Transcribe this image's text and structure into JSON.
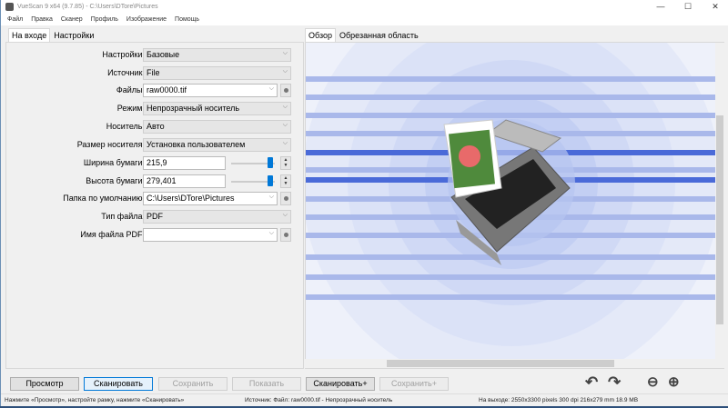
{
  "window": {
    "title": "VueScan 9 x64 (9.7.85) - C:\\Users\\DTore\\Pictures",
    "minimize": "—",
    "maximize": "☐",
    "close": "✕"
  },
  "menu": [
    "Файл",
    "Правка",
    "Сканер",
    "Профиль",
    "Изображение",
    "Помощь"
  ],
  "left_tabs": [
    {
      "label": "На входе",
      "active": true
    },
    {
      "label": "Настройки",
      "active": false
    }
  ],
  "right_tabs": [
    {
      "label": "Обзор",
      "active": true
    },
    {
      "label": "Обрезанная область",
      "active": false
    }
  ],
  "form": {
    "settings": {
      "label": "Настройки:",
      "value": "Базовые"
    },
    "source": {
      "label": "Источник:",
      "value": "File"
    },
    "files": {
      "label": "Файлы:",
      "value": "raw0000.tif"
    },
    "mode": {
      "label": "Режим:",
      "value": "Непрозрачный носитель"
    },
    "media": {
      "label": "Носитель:",
      "value": "Авто"
    },
    "media_size": {
      "label": "Размер носителя:",
      "value": "Установка пользователем"
    },
    "paper_width": {
      "label": "Ширина бумаги:",
      "value": "215,9",
      "slider": 1.0
    },
    "paper_height": {
      "label": "Высота бумаги:",
      "value": "279,401",
      "slider": 1.0
    },
    "default_folder": {
      "label": "Папка по умолчанию:",
      "value": "C:\\Users\\DTore\\Pictures"
    },
    "file_type": {
      "label": "Тип файла:",
      "value": "PDF"
    },
    "pdf_name": {
      "label": "Имя файла PDF:",
      "value": ""
    }
  },
  "buttons": {
    "preview": "Просмотр",
    "scan": "Сканировать",
    "save": "Сохранить",
    "show": "Показать",
    "scan_plus": "Сканировать+",
    "save_plus": "Сохранить+"
  },
  "status": {
    "hint": "Нажмите «Просмотр», настройте рамку, нажмите «Сканировать»",
    "source": "Источник: Файл: raw0000.tif - Непрозрачный носитель",
    "output": "На выходе: 2550x3300 pixels 300 dpi 216x279 mm 18.9 MB"
  },
  "colors": {
    "accent": "#0078d7",
    "preview_bg": "#e8ecf8",
    "stripe": "#a9b8ea",
    "stripe_dark": "#4a6ad8"
  }
}
